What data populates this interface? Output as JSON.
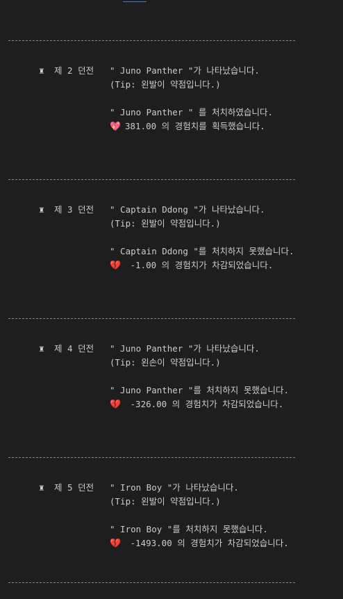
{
  "sections": [
    {
      "rook": "♜",
      "stage": "제 2 던전",
      "appear": "\" Juno Panther \"가 나타났습니다.",
      "tip": "(Tip: 왼발이 약점입니다.)",
      "result": "\" Juno Panther \" 를 처치하였습니다.",
      "heart": "💖",
      "heart_type": "win",
      "exp": "381.00 의 경험치를 획득했습니다."
    },
    {
      "rook": "♜",
      "stage": "제 3 던전",
      "appear": "\" Captain Ddong \"가 나타났습니다.",
      "tip": "(Tip: 왼발이 약점입니다.)",
      "result": "\" Captain Ddong \"를 처치하지 못했습니다.",
      "heart": "💔",
      "heart_type": "lose",
      "exp": " -1.00 의 경험치가 차감되었습니다."
    },
    {
      "rook": "♜",
      "stage": "제 4 던전",
      "appear": "\" Juno Panther \"가 나타났습니다.",
      "tip": "(Tip: 왼손이 약점입니다.)",
      "result": "\" Juno Panther \"를 처치하지 못했습니다.",
      "heart": "💔",
      "heart_type": "lose",
      "exp": " -326.00 의 경험치가 차감되었습니다."
    },
    {
      "rook": "♜",
      "stage": "제 5 던전",
      "appear": "\" Iron Boy \"가 나타났습니다.",
      "tip": "(Tip: 왼발이 약점입니다.)",
      "result": "\" Iron Boy \"를 처치하지 못했습니다.",
      "heart": "💔",
      "heart_type": "lose",
      "exp": " -1493.00 의 경험치가 차감되었습니다."
    }
  ],
  "colors": {
    "background": "#1e1e1e",
    "text": "#cccccc",
    "divider": "#8a8a8a",
    "link_underline": "#3b7fd6"
  }
}
